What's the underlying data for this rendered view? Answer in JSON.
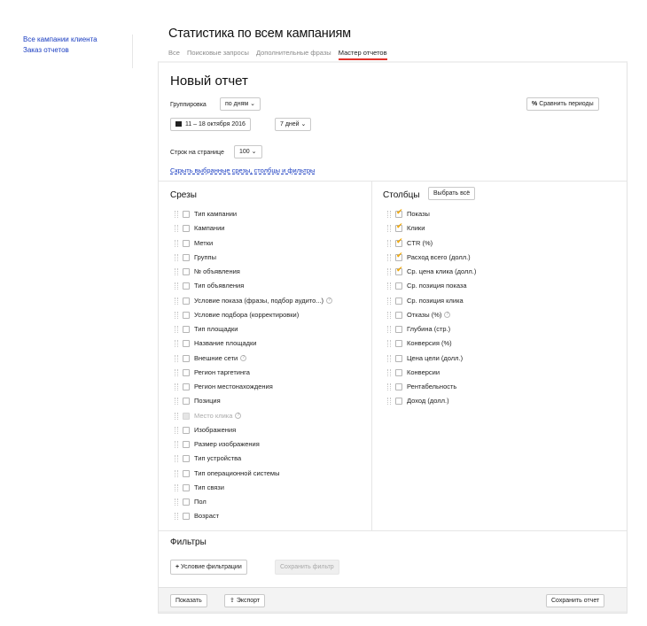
{
  "sidebar": {
    "links": [
      "Все кампании клиента",
      "Заказ отчетов"
    ]
  },
  "page_title": "Статистика по всем кампаниям",
  "tabs": [
    {
      "label": "Все",
      "active": false
    },
    {
      "label": "Поисковые запросы",
      "active": false
    },
    {
      "label": "Дополнительные фразы",
      "active": false
    },
    {
      "label": "Мастер отчетов",
      "active": true
    }
  ],
  "report": {
    "title": "Новый отчет",
    "grouping_label": "Группировка",
    "grouping_value": "по дням",
    "compare_button": "Сравнить периоды",
    "date_range": "11 – 18 октября 2016",
    "period": "7 дней",
    "rows_label": "Строк на странице",
    "rows_value": "100",
    "hide_link": "Скрыть выбранные срезы, столбцы и фильтры"
  },
  "slices": {
    "title": "Срезы",
    "items": [
      {
        "label": "Тип кампании",
        "checked": false,
        "disabled": false,
        "help": false
      },
      {
        "label": "Кампании",
        "checked": false,
        "disabled": false,
        "help": false
      },
      {
        "label": "Метки",
        "checked": false,
        "disabled": false,
        "help": false
      },
      {
        "label": "Группы",
        "checked": false,
        "disabled": false,
        "help": false
      },
      {
        "label": "№ объявления",
        "checked": false,
        "disabled": false,
        "help": false
      },
      {
        "label": "Тип объявления",
        "checked": false,
        "disabled": false,
        "help": false
      },
      {
        "label": "Условие показа (фразы, подбор аудито...)",
        "checked": false,
        "disabled": false,
        "help": true
      },
      {
        "label": "Условие подбора (корректировки)",
        "checked": false,
        "disabled": false,
        "help": false
      },
      {
        "label": "Тип площадки",
        "checked": false,
        "disabled": false,
        "help": false
      },
      {
        "label": "Название площадки",
        "checked": false,
        "disabled": false,
        "help": false
      },
      {
        "label": "Внешние сети",
        "checked": false,
        "disabled": false,
        "help": true
      },
      {
        "label": "Регион таргетинга",
        "checked": false,
        "disabled": false,
        "help": false
      },
      {
        "label": "Регион местонахождения",
        "checked": false,
        "disabled": false,
        "help": false
      },
      {
        "label": "Позиция",
        "checked": false,
        "disabled": false,
        "help": false
      },
      {
        "label": "Место клика",
        "checked": false,
        "disabled": true,
        "help": true
      },
      {
        "label": "Изображения",
        "checked": false,
        "disabled": false,
        "help": false
      },
      {
        "label": "Размер изображения",
        "checked": false,
        "disabled": false,
        "help": false
      },
      {
        "label": "Тип устройства",
        "checked": false,
        "disabled": false,
        "help": false
      },
      {
        "label": "Тип операционной системы",
        "checked": false,
        "disabled": false,
        "help": false
      },
      {
        "label": "Тип связи",
        "checked": false,
        "disabled": false,
        "help": false
      },
      {
        "label": "Пол",
        "checked": false,
        "disabled": false,
        "help": false
      },
      {
        "label": "Возраст",
        "checked": false,
        "disabled": false,
        "help": false
      }
    ]
  },
  "columns": {
    "title": "Столбцы",
    "select_all": "Выбрать всё",
    "items": [
      {
        "label": "Показы",
        "checked": true,
        "help": false
      },
      {
        "label": "Клики",
        "checked": true,
        "help": false
      },
      {
        "label": "CTR (%)",
        "checked": true,
        "help": false
      },
      {
        "label": "Расход всего (долл.)",
        "checked": true,
        "help": false
      },
      {
        "label": "Ср. цена клика (долл.)",
        "checked": true,
        "help": false
      },
      {
        "label": "Ср. позиция показа",
        "checked": false,
        "help": false
      },
      {
        "label": "Ср. позиция клика",
        "checked": false,
        "help": false
      },
      {
        "label": "Отказы (%)",
        "checked": false,
        "help": true
      },
      {
        "label": "Глубина (стр.)",
        "checked": false,
        "help": false
      },
      {
        "label": "Конверсия (%)",
        "checked": false,
        "help": false
      },
      {
        "label": "Цена цели (долл.)",
        "checked": false,
        "help": false
      },
      {
        "label": "Конверсии",
        "checked": false,
        "help": false
      },
      {
        "label": "Рентабельность",
        "checked": false,
        "help": false
      },
      {
        "label": "Доход (долл.)",
        "checked": false,
        "help": false
      }
    ]
  },
  "filters": {
    "title": "Фильтры",
    "add_condition": "Условие фильтрации",
    "save_filter": "Сохранить фильтр"
  },
  "footer": {
    "show": "Показать",
    "export": "Экспорт",
    "save_report": "Сохранить отчет"
  },
  "icons": {
    "calendar": "calendar-icon",
    "compare": "percent-icon",
    "export": "upload-icon",
    "plus": "plus-icon"
  }
}
